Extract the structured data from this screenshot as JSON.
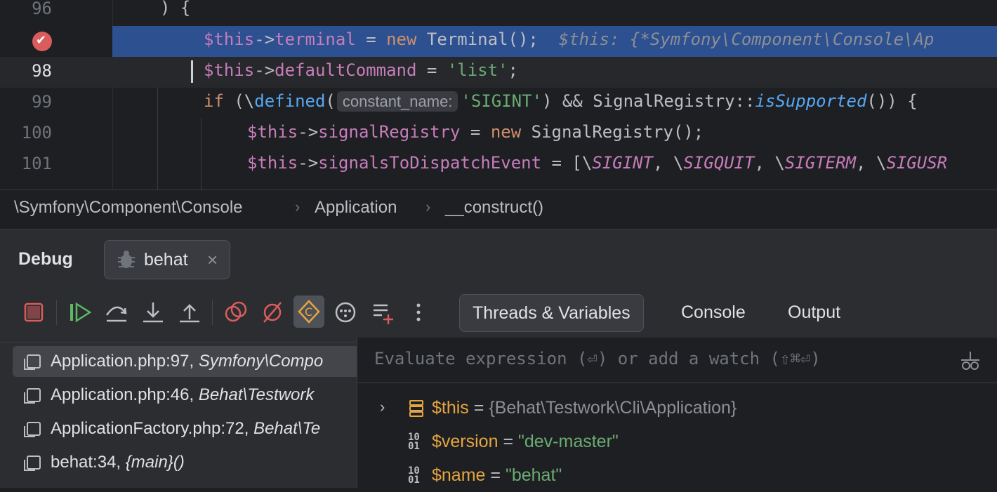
{
  "editor": {
    "lines": [
      {
        "num": "96",
        "text": ") {"
      },
      {
        "num": "",
        "var": "$this",
        "arrow": "->",
        "field": "terminal",
        "mid": " = ",
        "kw": "new",
        "rest": " Terminal();",
        "inlay": "  $this: {*Symfony\\Component\\Console\\Ap"
      },
      {
        "num": "98",
        "var": "$this",
        "arrow": "->",
        "field": "defaultCommand",
        "mid": " = ",
        "str": "'list'",
        "end": ";"
      },
      {
        "num": "99",
        "kw": "if",
        "p1": " (\\",
        "fn1": "defined",
        "p2": "(",
        "hint": "constant_name:",
        "str": "'SIGINT'",
        "p3": ") && SignalRegistry::",
        "fn2": "isSupported",
        "p4": "()) {"
      },
      {
        "num": "100",
        "var": "$this",
        "arrow": "->",
        "field": "signalRegistry",
        "mid": " = ",
        "kw": "new",
        "rest": " SignalRegistry();"
      },
      {
        "num": "101",
        "var": "$this",
        "arrow": "->",
        "field": "signalsToDispatchEvent",
        "mid": " = [\\",
        "c1": "SIGINT",
        "s1": ", \\",
        "c2": "SIGQUIT",
        "s2": ", \\",
        "c3": "SIGTERM",
        "s3": ", \\",
        "c4": "SIGUSR"
      }
    ]
  },
  "breadcrumb": [
    "\\Symfony\\Component\\Console",
    "Application",
    "__construct()"
  ],
  "debug": {
    "title": "Debug",
    "session": "behat",
    "view_tabs": [
      "Threads & Variables",
      "Console",
      "Output"
    ],
    "frames": [
      {
        "file": "Application.php:97, ",
        "ctx": "Symfony\\Compo"
      },
      {
        "file": "Application.php:46, ",
        "ctx": "Behat\\Testwork"
      },
      {
        "file": "ApplicationFactory.php:72, ",
        "ctx": "Behat\\Te"
      },
      {
        "file": "behat:34, ",
        "ctx": "{main}()"
      }
    ],
    "eval_placeholder": "Evaluate expression (⏎) or add a watch (⇧⌘⏎)",
    "variables": [
      {
        "name": "$this",
        "eq": " = ",
        "value": "{Behat\\Testwork\\Cli\\Application}",
        "expandable": true
      },
      {
        "name": "$version",
        "eq": " = ",
        "value": "\"dev-master\"",
        "expandable": false
      },
      {
        "name": "$name",
        "eq": " = ",
        "value": "\"behat\"",
        "expandable": false
      }
    ]
  },
  "colors": {
    "accent": "#2d5090",
    "breakpoint": "#db5c5c",
    "string": "#6aab73",
    "keyword": "#cf8e6d",
    "field": "#c77dbb"
  }
}
